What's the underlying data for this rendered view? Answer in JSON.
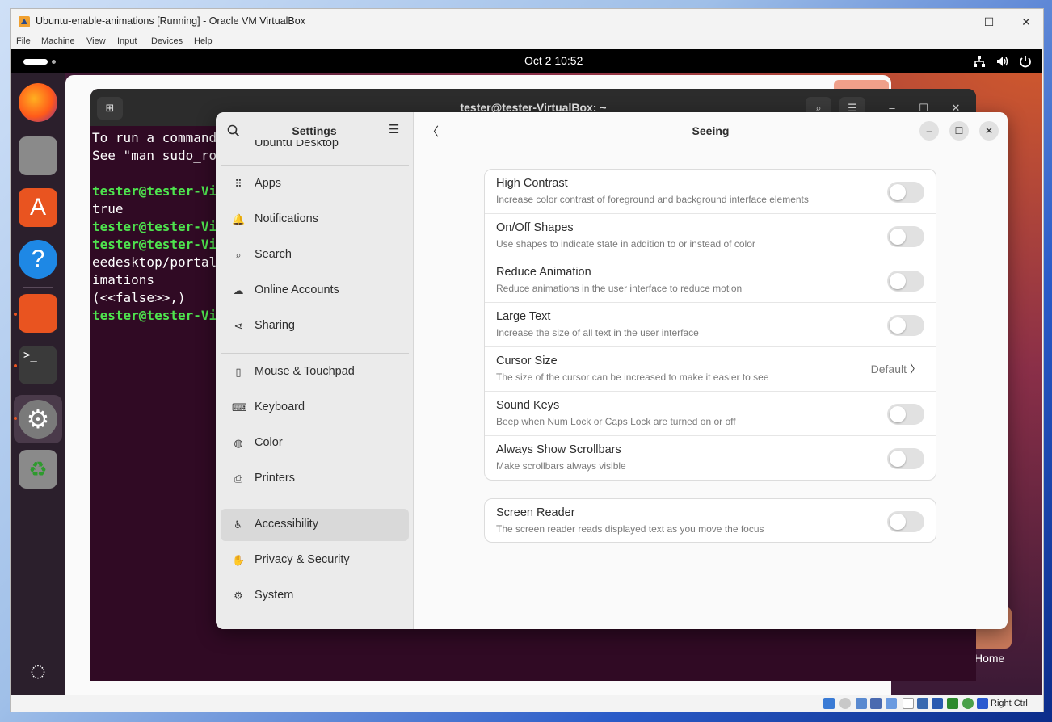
{
  "vbox": {
    "title": "Ubuntu-enable-animations [Running] - Oracle VM VirtualBox",
    "menu": [
      "File",
      "Machine",
      "View",
      "Input",
      "Devices",
      "Help"
    ],
    "status_text": "Right Ctrl",
    "minimize": "–",
    "maximize": "☐",
    "close": "✕"
  },
  "guest": {
    "clock": "Oct 2  10:52",
    "terminal": {
      "title": "tester@tester-VirtualBox: ~",
      "lines": [
        {
          "text": "To run a command",
          "green": false
        },
        {
          "text": "See \"man sudo_ro",
          "green": false
        },
        {
          "text": "",
          "green": false
        },
        {
          "text": "tester@tester-Vi",
          "green": true
        },
        {
          "text": "true",
          "green": false
        },
        {
          "text": "tester@tester-Vi",
          "green": true
        },
        {
          "text": "tester@tester-Vi",
          "green": true
        },
        {
          "text": "eedesktop/portal",
          "green": false
        },
        {
          "text": "imations",
          "green": false
        },
        {
          "text": "(<<false>>,)",
          "green": false
        },
        {
          "text": "tester@tester-Vi",
          "green": true
        }
      ]
    },
    "desktop_home_label": "Home"
  },
  "settings": {
    "sidebar_title": "Settings",
    "partial_item": "Ubuntu Desktop",
    "items": [
      {
        "label": "Apps",
        "icon": "apps-grid-icon",
        "glyph": "⠿"
      },
      {
        "label": "Notifications",
        "icon": "bell-icon",
        "glyph": "🔔"
      },
      {
        "label": "Search",
        "icon": "search-icon",
        "glyph": "⌕"
      },
      {
        "label": "Online Accounts",
        "icon": "cloud-icon",
        "glyph": "☁"
      },
      {
        "label": "Sharing",
        "icon": "share-icon",
        "glyph": "⋖"
      },
      {
        "label": "Mouse & Touchpad",
        "icon": "mouse-icon",
        "glyph": "▯"
      },
      {
        "label": "Keyboard",
        "icon": "keyboard-icon",
        "glyph": "⌨"
      },
      {
        "label": "Color",
        "icon": "color-icon",
        "glyph": "◍"
      },
      {
        "label": "Printers",
        "icon": "printer-icon",
        "glyph": "⎙"
      },
      {
        "label": "Accessibility",
        "icon": "accessibility-icon",
        "glyph": "♿"
      },
      {
        "label": "Privacy & Security",
        "icon": "hand-icon",
        "glyph": "✋"
      },
      {
        "label": "System",
        "icon": "gear-icon",
        "glyph": "⚙"
      }
    ],
    "page_title": "Seeing",
    "back_glyph": "〈",
    "seeing_rows": [
      {
        "title": "High Contrast",
        "subtitle": "Increase color contrast of foreground and background interface elements",
        "type": "switch",
        "on": false
      },
      {
        "title": "On/Off Shapes",
        "subtitle": "Use shapes to indicate state in addition to or instead of color",
        "type": "switch",
        "on": false
      },
      {
        "title": "Reduce Animation",
        "subtitle": "Reduce animations in the user interface to reduce motion",
        "type": "switch",
        "on": false
      },
      {
        "title": "Large Text",
        "subtitle": "Increase the size of all text in the user interface",
        "type": "switch",
        "on": false
      },
      {
        "title": "Cursor Size",
        "subtitle": "The size of the cursor can be increased to make it easier to see",
        "type": "link",
        "value": "Default"
      },
      {
        "title": "Sound Keys",
        "subtitle": "Beep when Num Lock or Caps Lock are turned on or off",
        "type": "switch",
        "on": false
      },
      {
        "title": "Always Show Scrollbars",
        "subtitle": "Make scrollbars always visible",
        "type": "switch",
        "on": false
      }
    ],
    "screen_reader": {
      "title": "Screen Reader",
      "subtitle": "The screen reader reads displayed text as you move the focus",
      "on": false
    }
  },
  "colors": {
    "ubuntu_orange": "#e95420",
    "terminal_bg": "#300a24",
    "prompt_green": "#4ee44e"
  }
}
